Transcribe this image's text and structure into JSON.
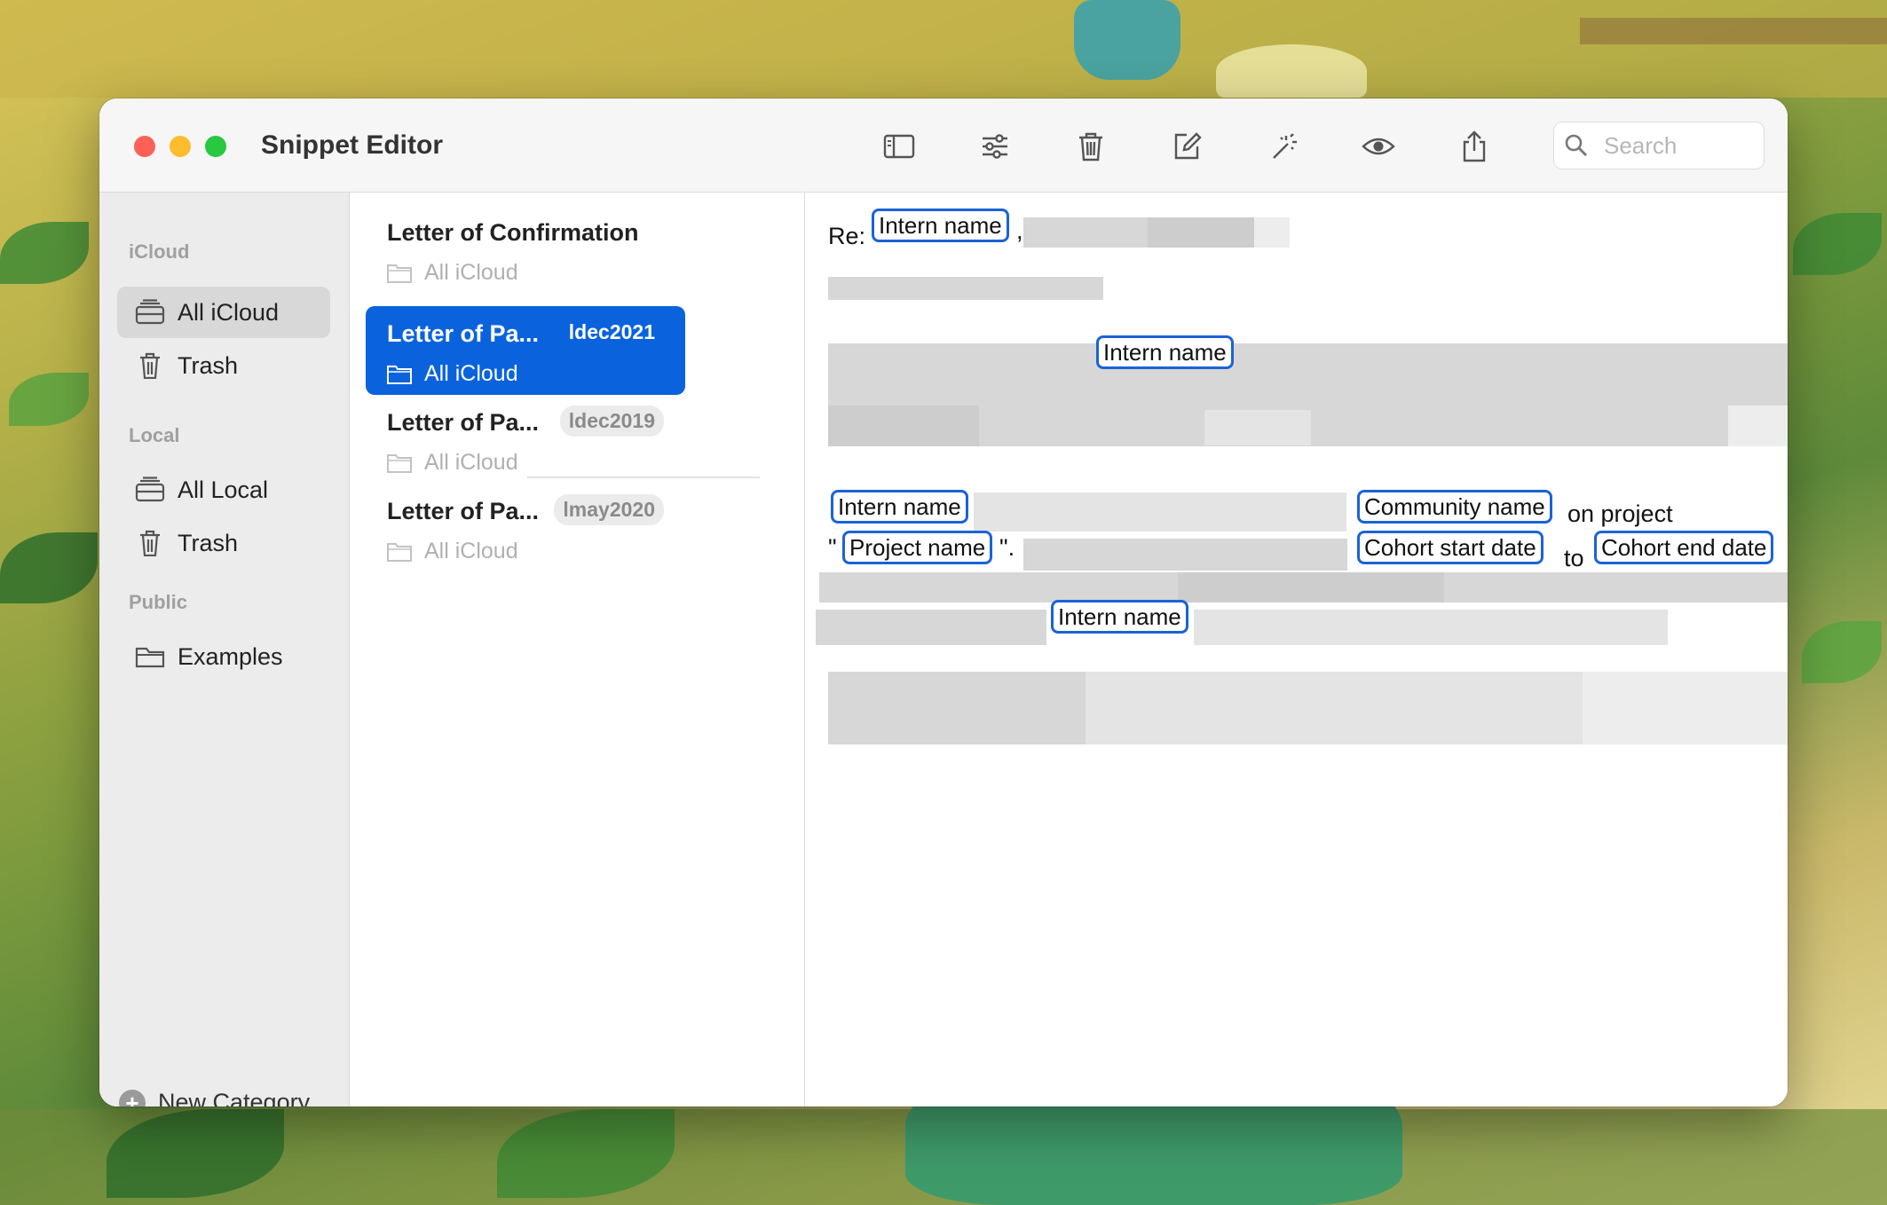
{
  "window": {
    "title": "Snippet Editor"
  },
  "toolbar": {
    "buttons": [
      {
        "icon": "sidebar-toggle-icon"
      },
      {
        "icon": "sliders-icon"
      },
      {
        "icon": "trash-icon"
      },
      {
        "icon": "compose-icon"
      },
      {
        "icon": "magic-wand-icon"
      },
      {
        "icon": "eye-icon"
      },
      {
        "icon": "share-icon"
      }
    ],
    "search_placeholder": "Search"
  },
  "sidebar": {
    "sections": [
      {
        "label": "iCloud",
        "items": [
          {
            "label": "All iCloud",
            "icon": "tray-icon",
            "selected": true
          },
          {
            "label": "Trash",
            "icon": "trash-icon"
          }
        ]
      },
      {
        "label": "Local",
        "items": [
          {
            "label": "All Local",
            "icon": "tray-icon"
          },
          {
            "label": "Trash",
            "icon": "trash-icon"
          }
        ]
      },
      {
        "label": "Public",
        "items": [
          {
            "label": "Examples",
            "icon": "folder-icon"
          }
        ]
      }
    ],
    "new_category": "New Category"
  },
  "snippets": [
    {
      "name": "Letter of Confirmation",
      "tag": "",
      "folder": "All iCloud"
    },
    {
      "name": "Letter of Pa...",
      "tag": "ldec2021",
      "folder": "All iCloud",
      "selected": true
    },
    {
      "name": "Letter of Pa...",
      "tag": "ldec2019",
      "folder": "All iCloud"
    },
    {
      "name": "Letter of Pa...",
      "tag": "lmay2020",
      "folder": "All iCloud"
    }
  ],
  "editor": {
    "re_label": "Re:",
    "tokens": {
      "intern_name": "Intern name",
      "community_name": "Community name",
      "project_name": "Project name",
      "cohort_start": "Cohort start date",
      "cohort_end": "Cohort end date"
    },
    "text": {
      "on_project": "on project",
      "to": "to",
      "quote_open": "\"",
      "quote_close": "\".",
      "period": ".",
      "comma": ","
    }
  },
  "colors": {
    "accent": "#0a63dd",
    "token_border": "#1b63d6"
  }
}
